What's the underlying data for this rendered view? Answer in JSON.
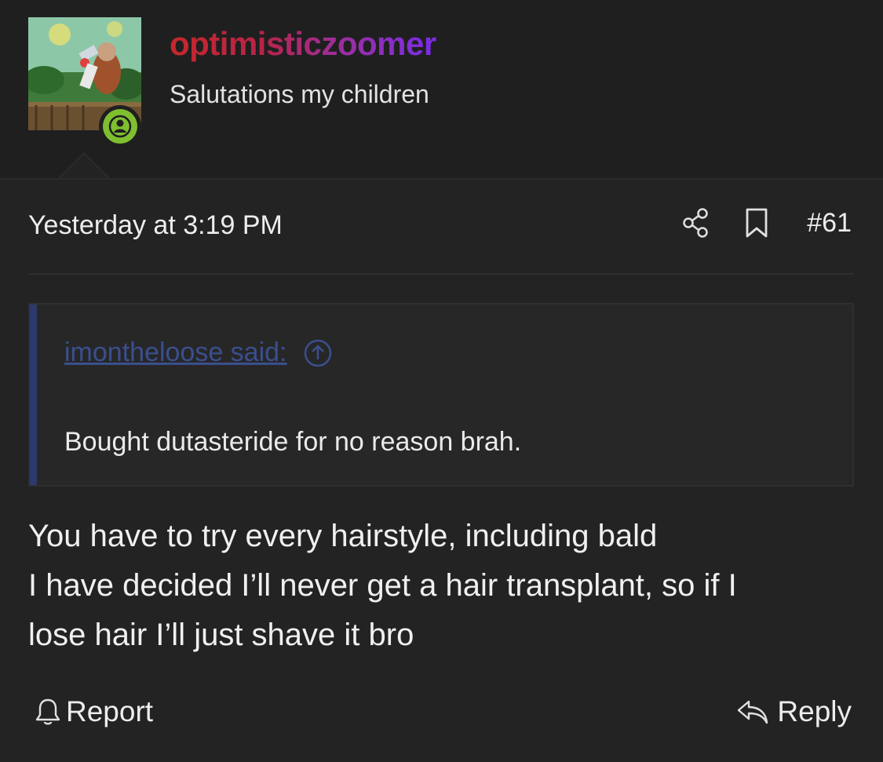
{
  "user": {
    "name": "optimisticzoomer",
    "title": "Salutations my children"
  },
  "post": {
    "timestamp": "Yesterday at 3:19 PM",
    "number": "#61"
  },
  "quote": {
    "author": "imontheloose said:",
    "text": "Bought dutasteride for no reason brah."
  },
  "message": {
    "lines": [
      "You have to try every hairstyle, including bald",
      "I have decided I’ll never get a hair transplant, so if I",
      "lose hair I’ll just shave it bro"
    ]
  },
  "actions": {
    "report": "Report",
    "reply": "Reply"
  },
  "icons": {
    "share": "share-icon",
    "bookmark": "bookmark-icon",
    "jump": "arrow-up-circle-icon",
    "report": "bell-icon",
    "reply": "reply-icon",
    "online": "user-online-icon"
  },
  "colors": {
    "background": "#1e1e1f",
    "username_gradient_start": "#c5282a",
    "username_gradient_end": "#7a2ce8",
    "quote_bar": "#2c3a6c",
    "quote_link": "#3a4f8e",
    "online_badge": "#7fbf2f"
  }
}
